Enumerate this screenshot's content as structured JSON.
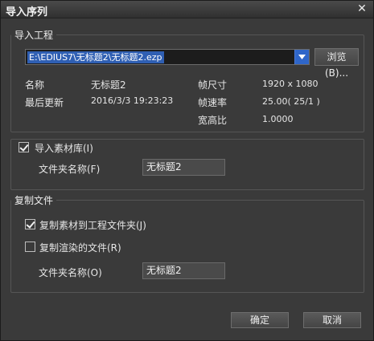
{
  "window": {
    "title": "导入序列"
  },
  "import_project": {
    "group_label": "导入工程",
    "path_value": "E:\\EDIUS7\\无标题2\\无标题2.ezp",
    "browse_label": "浏览(B)...",
    "info": {
      "name_label": "名称",
      "name_value": "无标题2",
      "updated_label": "最后更新",
      "updated_value": "2016/3/3 19:23:23",
      "frame_size_label": "帧尺寸",
      "frame_size_value": "1920 x 1080",
      "frame_rate_label": "帧速率",
      "frame_rate_value": "25.00( 25/1 )",
      "aspect_label": "宽高比",
      "aspect_value": "1.0000"
    }
  },
  "import_bin": {
    "checkbox_label": "导入素材库(I)",
    "checked": true,
    "folder_label": "文件夹名称(F)",
    "folder_value": "无标题2"
  },
  "copy_files": {
    "group_label": "复制文件",
    "copy_clips_label": "复制素材到工程文件夹(J)",
    "copy_clips_checked": true,
    "copy_rendered_label": "复制渲染的文件(R)",
    "copy_rendered_checked": false,
    "folder_label": "文件夹名称(O)",
    "folder_value": "无标题2"
  },
  "buttons": {
    "ok": "确定",
    "cancel": "取消"
  }
}
